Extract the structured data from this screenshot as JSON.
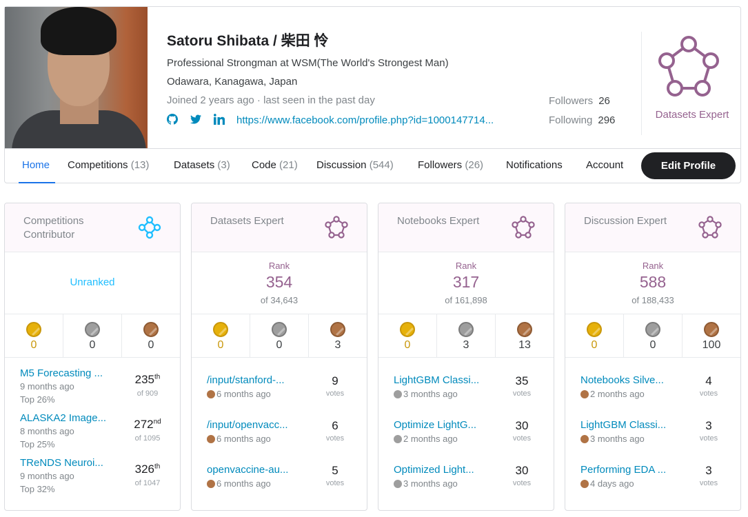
{
  "profile": {
    "name": "Satoru Shibata / 柴田 怜",
    "occupation": "Professional Strongman at WSM(The World's Strongest Man)",
    "location": "Odawara, Kanagawa, Japan",
    "joined": "Joined 2 years ago · last seen in the past day",
    "facebook_link": "https://www.facebook.com/profile.php?id=1000147714...",
    "followers_label": "Followers",
    "followers_count": "26",
    "following_label": "Following",
    "following_count": "296",
    "tier_label": "Datasets Expert",
    "colors": {
      "expert": "#95628f",
      "contributor": "#20beff",
      "link": "#008abc",
      "active_tab": "#1a73e8"
    }
  },
  "nav": {
    "home": "Home",
    "competitions": "Competitions",
    "competitions_count": "(13)",
    "datasets": "Datasets",
    "datasets_count": "(3)",
    "code": "Code",
    "code_count": "(21)",
    "discussion": "Discussion",
    "discussion_count": "(544)",
    "followers": "Followers",
    "followers_count": "(26)",
    "notifications": "Notifications",
    "account": "Account",
    "edit_profile": "Edit Profile"
  },
  "cards": {
    "competitions": {
      "title": "Competitions Contributor",
      "status": "Unranked",
      "icon": "contributor-icon",
      "medals": {
        "gold": "0",
        "silver": "0",
        "bronze": "0"
      },
      "items": [
        {
          "title": "M5 Forecasting ...",
          "when": "9 months ago",
          "top": "Top 26%",
          "place": "235",
          "suffix": "th",
          "of": "of 909"
        },
        {
          "title": "ALASKA2 Image...",
          "when": "8 months ago",
          "top": "Top 25%",
          "place": "272",
          "suffix": "nd",
          "of": "of 1095"
        },
        {
          "title": "TReNDS Neuroi...",
          "when": "9 months ago",
          "top": "Top 32%",
          "place": "326",
          "suffix": "th",
          "of": "of 1047"
        }
      ]
    },
    "datasets": {
      "title": "Datasets Expert",
      "rank_label": "Rank",
      "rank": "354",
      "of": "of 34,643",
      "icon": "expert-icon",
      "medals": {
        "gold": "0",
        "silver": "0",
        "bronze": "3"
      },
      "votes_label": "votes",
      "items": [
        {
          "title": "/input/stanford-...",
          "medal": "bronze",
          "when": "6 months ago",
          "votes": "9"
        },
        {
          "title": "/input/openvacc...",
          "medal": "bronze",
          "when": "6 months ago",
          "votes": "6"
        },
        {
          "title": "openvaccine-au...",
          "medal": "bronze",
          "when": "6 months ago",
          "votes": "5"
        }
      ]
    },
    "notebooks": {
      "title": "Notebooks Expert",
      "rank_label": "Rank",
      "rank": "317",
      "of": "of 161,898",
      "icon": "expert-icon",
      "medals": {
        "gold": "0",
        "silver": "3",
        "bronze": "13"
      },
      "votes_label": "votes",
      "items": [
        {
          "title": "LightGBM Classi...",
          "medal": "silver",
          "when": "3 months ago",
          "votes": "35"
        },
        {
          "title": "Optimize LightG...",
          "medal": "silver",
          "when": "2 months ago",
          "votes": "30"
        },
        {
          "title": "Optimized Light...",
          "medal": "silver",
          "when": "3 months ago",
          "votes": "30"
        }
      ]
    },
    "discussion": {
      "title": "Discussion Expert",
      "rank_label": "Rank",
      "rank": "588",
      "of": "of 188,433",
      "icon": "expert-icon",
      "medals": {
        "gold": "0",
        "silver": "0",
        "bronze": "100"
      },
      "votes_label": "votes",
      "items": [
        {
          "title": "Notebooks Silve...",
          "medal": "bronze",
          "when": "2 months ago",
          "votes": "4"
        },
        {
          "title": "LightGBM Classi...",
          "medal": "bronze",
          "when": "3 months ago",
          "votes": "3"
        },
        {
          "title": "Performing EDA ...",
          "medal": "bronze",
          "when": "4 days ago",
          "votes": "3"
        }
      ]
    }
  }
}
